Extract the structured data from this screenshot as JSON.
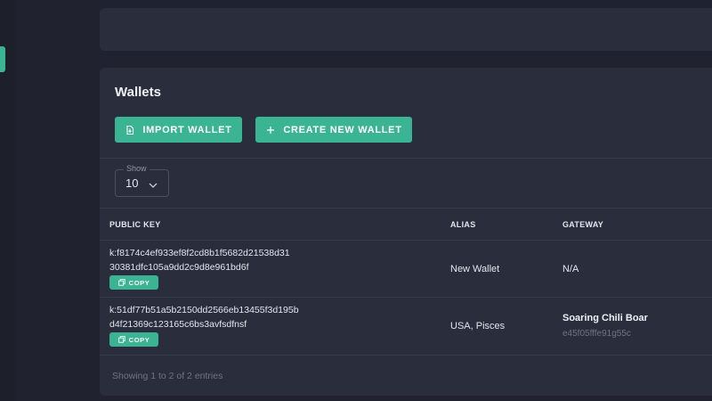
{
  "page": {
    "title": "Wallets"
  },
  "buttons": {
    "import_label": "IMPORT WALLET",
    "create_label": "CREATE NEW WALLET"
  },
  "show": {
    "legend": "Show",
    "value": "10"
  },
  "table": {
    "headers": {
      "public_key": "PUBLIC KEY",
      "alias": "ALIAS",
      "gateway": "GATEWAY"
    },
    "copy_label": "COPY",
    "rows": [
      {
        "key_line1": "k:f8174c4ef933ef8f2cd8b1f5682d21538d31",
        "key_line2": "30381dfc105a9dd2c9d8e961bd6f",
        "alias": "New Wallet",
        "gateway_name": "N/A",
        "gateway_sub": ""
      },
      {
        "key_line1": "k:51df77b51a5b2150dd2566eb13455f3d195b",
        "key_line2": "d4f21369c123165c6bs3avfsdfnsf",
        "alias": "USA, Pisces",
        "gateway_name": "Soaring Chili Boar",
        "gateway_sub": "e45f05fffe91g55c"
      }
    ]
  },
  "footer": {
    "entries_text": "Showing 1 to 2 of 2 entries"
  },
  "colors": {
    "accent": "#3ab493",
    "background": "#20232f",
    "card": "#2a2d3b"
  },
  "icons": {
    "import": "import-wallet-icon",
    "create": "plus-icon",
    "copy": "copy-icon",
    "dropdown": "chevron-down-icon"
  }
}
